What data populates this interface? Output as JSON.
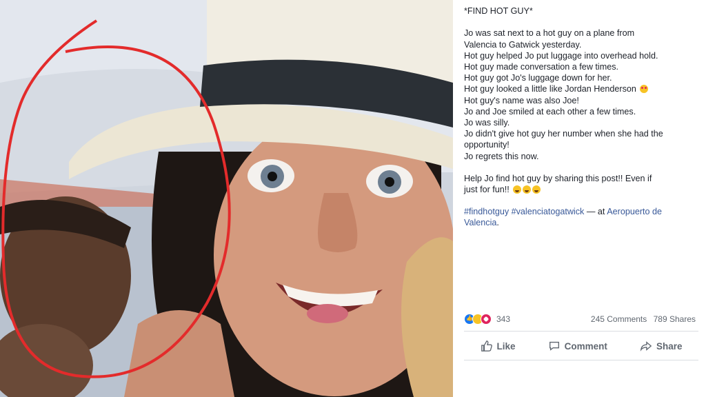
{
  "post": {
    "lines": [
      "*FIND HOT GUY*",
      "",
      "Jo was sat next to a hot guy on a plane from",
      "Valencia to Gatwick yesterday.",
      "Hot guy helped Jo put luggage into overhead hold.",
      "Hot guy made conversation a few times.",
      "Hot guy got Jo's luggage down for her.",
      "Hot guy looked a little like Jordan Henderson",
      "Hot guy's name was also Joe!",
      "Jo and Joe smiled at each other a few times.",
      "Jo was silly.",
      "Jo didn't give hot guy her number when she had the",
      "opportunity!",
      "Jo regrets this now."
    ],
    "help_line_1": "Help Jo find hot guy by sharing this post!! Even if",
    "help_line_2": "just for fun!!",
    "hashtags": "#findhotguy #valenciatogatwick",
    "location_prefix": " — at ",
    "location_1": "Aeropuerto de",
    "location_2": "Valencia",
    "location_suffix": "."
  },
  "reactions": {
    "icons": [
      "like-icon",
      "haha-icon",
      "love-icon"
    ],
    "count": "343",
    "comments": "245 Comments",
    "shares": "789 Shares"
  },
  "actions": {
    "like": "Like",
    "comment": "Comment",
    "share": "Share"
  },
  "colors": {
    "text": "#1d2129",
    "link": "#385898",
    "muted": "#606770",
    "circle": "#e32b2b",
    "hat_band": "#2b3036"
  }
}
